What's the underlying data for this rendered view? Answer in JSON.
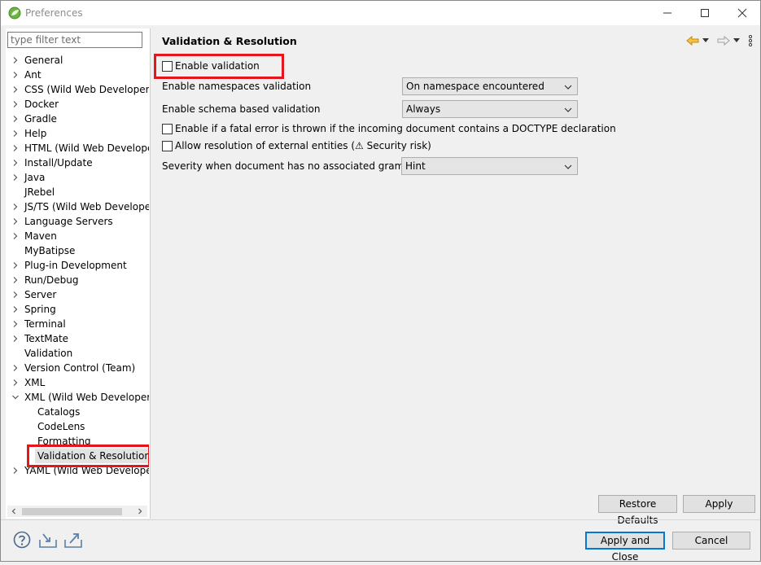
{
  "window": {
    "title": "Preferences"
  },
  "filter": {
    "placeholder": "type filter text",
    "value": ""
  },
  "tree": {
    "items": [
      {
        "label": "General",
        "expandable": true
      },
      {
        "label": "Ant",
        "expandable": true
      },
      {
        "label": "CSS (Wild Web Developer)",
        "expandable": true
      },
      {
        "label": "Docker",
        "expandable": true
      },
      {
        "label": "Gradle",
        "expandable": true
      },
      {
        "label": "Help",
        "expandable": true
      },
      {
        "label": "HTML (Wild Web Develope",
        "expandable": true
      },
      {
        "label": "Install/Update",
        "expandable": true
      },
      {
        "label": "Java",
        "expandable": true
      },
      {
        "label": "JRebel",
        "expandable": false
      },
      {
        "label": "JS/TS (Wild Web Develope",
        "expandable": true
      },
      {
        "label": "Language Servers",
        "expandable": true
      },
      {
        "label": "Maven",
        "expandable": true
      },
      {
        "label": "MyBatipse",
        "expandable": false
      },
      {
        "label": "Plug-in Development",
        "expandable": true
      },
      {
        "label": "Run/Debug",
        "expandable": true
      },
      {
        "label": "Server",
        "expandable": true
      },
      {
        "label": "Spring",
        "expandable": true
      },
      {
        "label": "Terminal",
        "expandable": true
      },
      {
        "label": "TextMate",
        "expandable": true
      },
      {
        "label": "Validation",
        "expandable": false
      },
      {
        "label": "Version Control (Team)",
        "expandable": true
      },
      {
        "label": "XML",
        "expandable": true
      },
      {
        "label": "XML (Wild Web Developer)",
        "expandable": true,
        "expanded": true
      },
      {
        "label": "Catalogs",
        "child": true
      },
      {
        "label": "CodeLens",
        "child": true
      },
      {
        "label": "Formatting",
        "child": true
      },
      {
        "label": "Validation & Resolution",
        "child": true,
        "selected": true
      },
      {
        "label": "YAML (Wild Web Develope",
        "expandable": true
      }
    ]
  },
  "page": {
    "title": "Validation & Resolution",
    "enable_validation": {
      "label": "Enable validation",
      "checked": false
    },
    "namespaces": {
      "label": "Enable namespaces validation",
      "value": "On namespace encountered"
    },
    "schema": {
      "label": "Enable schema based validation",
      "value": "Always"
    },
    "doctype_error": {
      "label": "Enable if a fatal error is thrown if the incoming document contains a DOCTYPE declaration",
      "checked": false
    },
    "external_entities": {
      "label": "Allow resolution of external entities (⚠ Security risk)",
      "checked": false
    },
    "no_grammar": {
      "label": "Severity when document has no associated grammar",
      "value": "Hint"
    }
  },
  "buttons": {
    "restore_defaults": "Restore Defaults",
    "apply": "Apply",
    "apply_and_close": "Apply and Close",
    "cancel": "Cancel"
  },
  "colors": {
    "highlight": "#e8141b",
    "nav_arrow": "#e6a817",
    "default_button_border": "#0078d7"
  },
  "icons": {
    "app": "eclipse-spring-leaf-icon",
    "back": "back-arrow-icon",
    "forward": "forward-arrow-icon",
    "menu": "view-menu-icon",
    "help": "help-icon",
    "import": "import-icon",
    "export": "export-icon"
  }
}
